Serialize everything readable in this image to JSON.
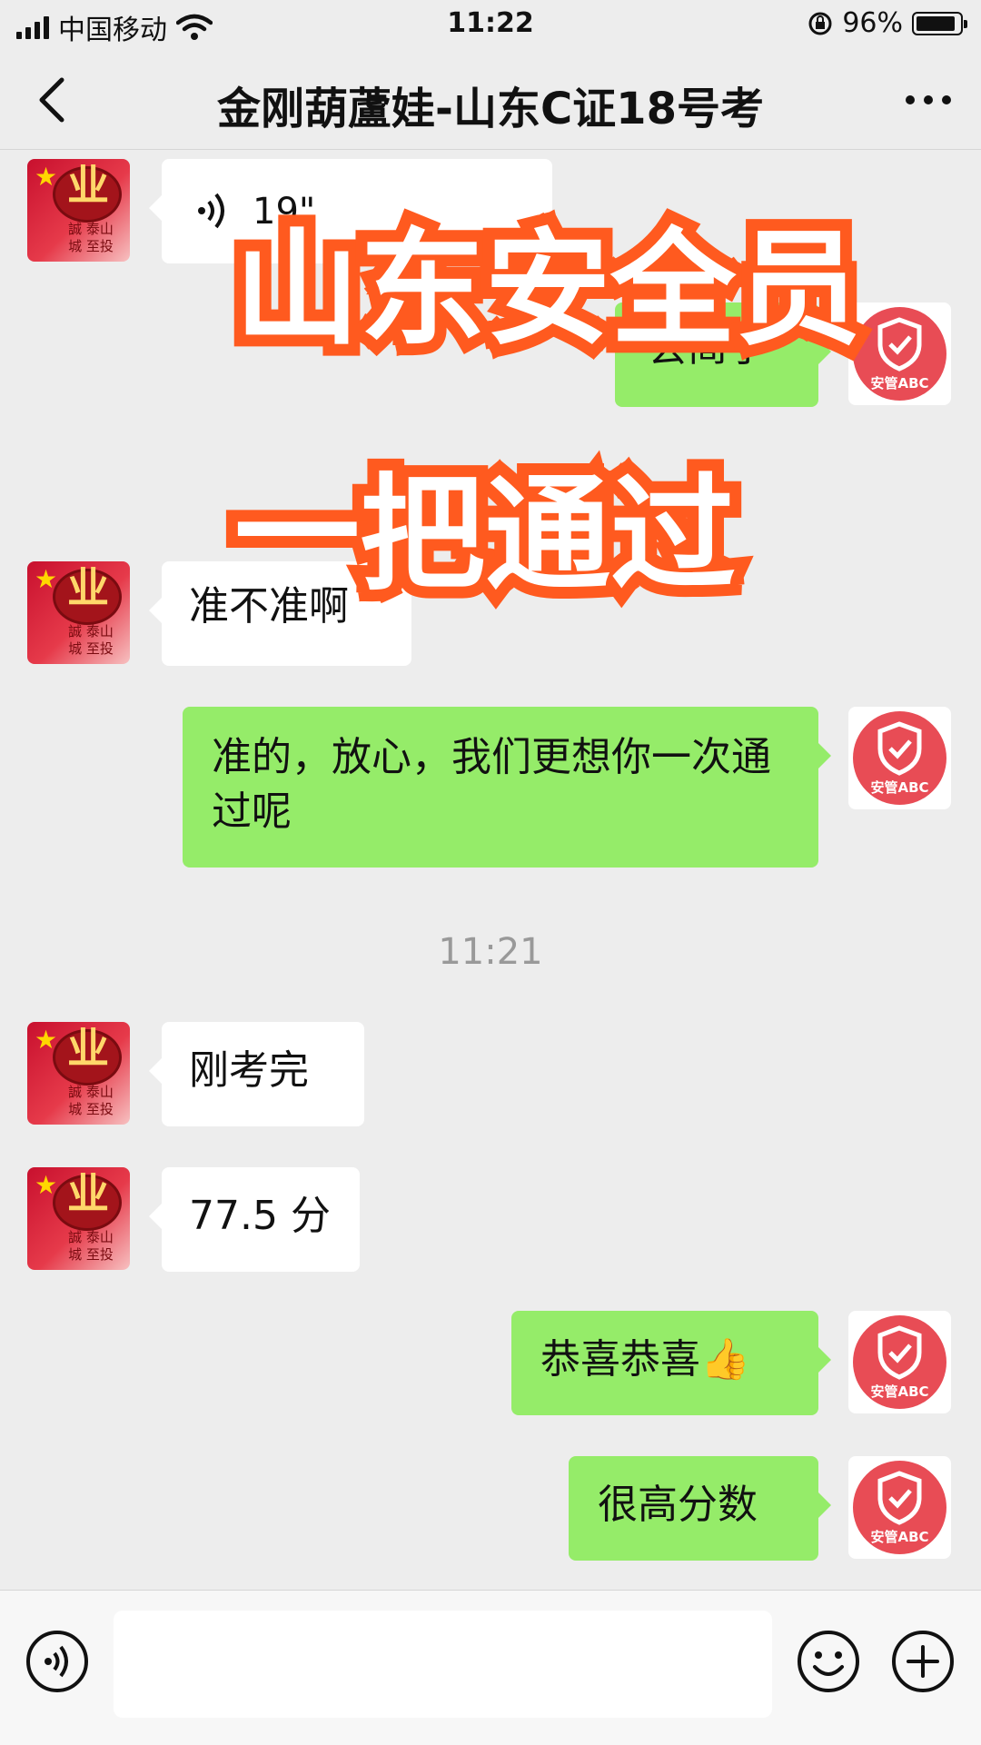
{
  "status_bar": {
    "carrier": "中国移动",
    "time": "11:22",
    "battery_percent": "96%",
    "battery_level": 0.96
  },
  "nav": {
    "title": "金刚葫蘆娃-山东C证18号考",
    "back_icon": "chevron-left-icon",
    "more_icon": "more-dots-icon"
  },
  "avatars": {
    "left_motto": "誠 泰山\n城 至投",
    "right_label": "安管ABC"
  },
  "messages": {
    "voice_duration": "19\"",
    "partial_sent": "会简了",
    "ask_accuracy": "准不准啊",
    "reply_accurate": "准的，放心，我们更想你一次通过呢",
    "timestamp": "11:21",
    "just_finished": "刚考完",
    "score": "77.5 分",
    "congrats": "恭喜恭喜👍",
    "high_score": "很高分数"
  },
  "overlay": {
    "line1": "山东安全员",
    "line2": "一把通过"
  },
  "input_bar": {
    "voice_icon": "voice-input-icon",
    "emoji_icon": "emoji-icon",
    "plus_icon": "plus-icon",
    "input_value": ""
  },
  "colors": {
    "background": "#ededed",
    "sent_bubble": "#95ec69",
    "received_bubble": "#ffffff",
    "overlay_stroke": "#ff5a1f",
    "avatar_badge": "#e84c55"
  }
}
